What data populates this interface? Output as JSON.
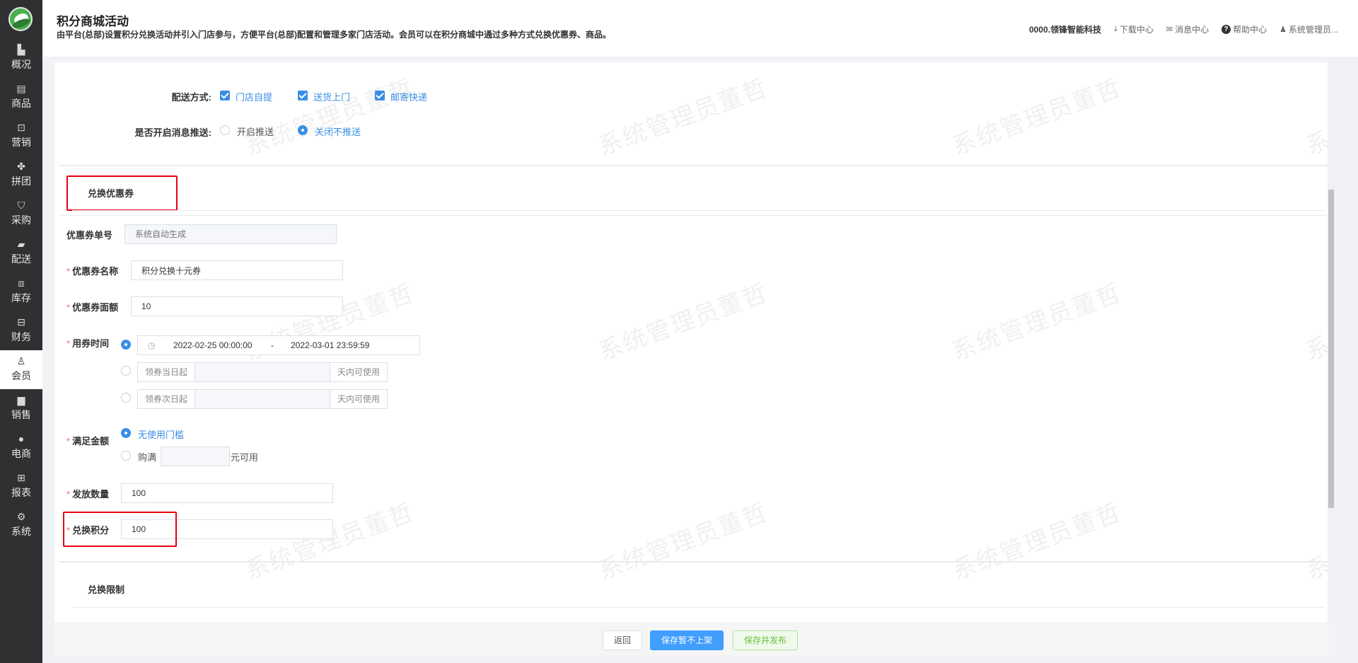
{
  "sidebar": {
    "items": [
      {
        "label": "概况",
        "icon": "building-icon"
      },
      {
        "label": "商品",
        "icon": "document-icon"
      },
      {
        "label": "营销",
        "icon": "lock-icon"
      },
      {
        "label": "拼团",
        "icon": "grid-icon"
      },
      {
        "label": "采购",
        "icon": "cart-icon"
      },
      {
        "label": "配送",
        "icon": "truck-icon"
      },
      {
        "label": "库存",
        "icon": "box-icon"
      },
      {
        "label": "财务",
        "icon": "finance-icon"
      },
      {
        "label": "会员",
        "icon": "user-icon"
      },
      {
        "label": "销售",
        "icon": "register-icon"
      },
      {
        "label": "电商",
        "icon": "person-icon"
      },
      {
        "label": "报表",
        "icon": "chart-icon"
      },
      {
        "label": "系统",
        "icon": "gear-icon"
      }
    ],
    "active": "会员"
  },
  "header": {
    "title": "积分商城活动",
    "description": "由平台(总部)设置积分兑换活动并引入门店参与，方便平台(总部)配置和管理多家门店活动。会员可以在积分商城中通过多种方式兑换优惠券、商品。",
    "company": "0000.领锋智能科技",
    "links": {
      "download": "下载中心",
      "messages": "消息中心",
      "help": "帮助中心",
      "user": "系统管理员..."
    }
  },
  "delivery": {
    "label": "配送方式:",
    "options": [
      "门店自提",
      "送货上门",
      "邮寄快递"
    ]
  },
  "push": {
    "label": "是否开启消息推送:",
    "options": [
      "开启推送",
      "关闭不推送"
    ],
    "selected": "关闭不推送"
  },
  "coupon_section": {
    "title": "兑换优惠券",
    "number_label": "优惠券单号",
    "number_placeholder": "系统自动生成",
    "name_label": "优惠券名称",
    "name_value": "积分兑换十元券",
    "amount_label": "优惠券面额",
    "amount_value": "10",
    "time_label": "用券时间",
    "date_start": "2022-02-25 00:00:00",
    "date_sep": "-",
    "date_end": "2022-03-01 23:59:59",
    "same_day_prefix": "领券当日起",
    "next_day_prefix": "领券次日起",
    "days_suffix": "天内可使用",
    "threshold_label": "满足金额",
    "threshold_none": "无使用门槛",
    "threshold_prefix": "购满",
    "threshold_suffix": "元可用",
    "issue_label": "发放数量",
    "issue_value": "100",
    "points_label": "兑换积分",
    "points_value": "100"
  },
  "limit_section": {
    "title": "兑换限制"
  },
  "watermark": "系统管理员董哲",
  "footer": {
    "back": "返回",
    "save": "保存暂不上架",
    "publish": "保存并发布"
  },
  "colors": {
    "accent": "#409eff",
    "highlight": "#e60012",
    "sidebar": "#2f3032"
  }
}
